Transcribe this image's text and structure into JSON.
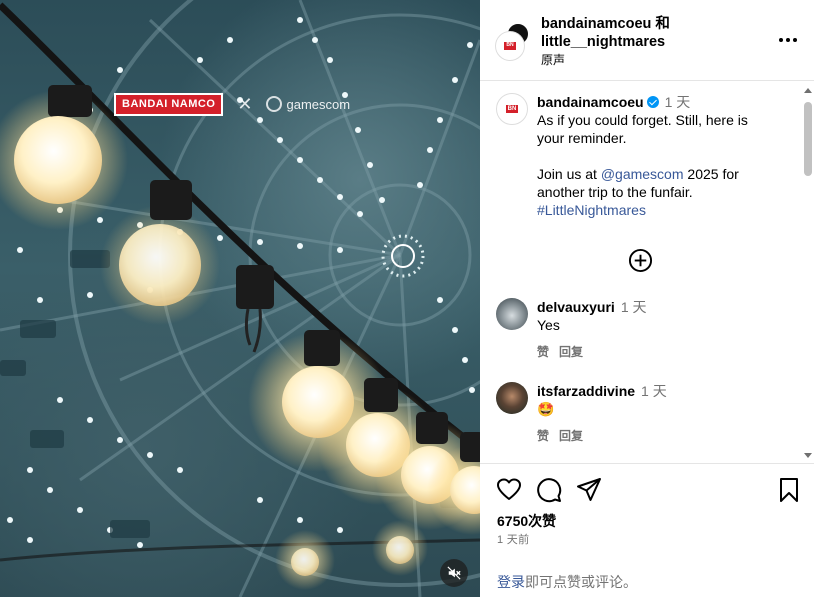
{
  "media": {
    "brand_logo_text": "BANDAI NAMCO",
    "times_symbol": "✕",
    "partner_text": "gamescom",
    "mute_icon": "speaker-muted-icon"
  },
  "header": {
    "title": "bandainamcoeu 和 little__nightmares",
    "subtitle": "原声"
  },
  "caption": {
    "username": "bandainamcoeu",
    "time": "1 天",
    "line1": "As if you could forget. Still, here is your reminder.",
    "line2_pre": "Join us at ",
    "mention": "@gamescom",
    "line2_post": " 2025 for another trip to the funfair.",
    "hashtag": "#LittleNightmares"
  },
  "comments": [
    {
      "username": "delvauxyuri",
      "time": "1 天",
      "text": "Yes",
      "like": "赞",
      "reply": "回复"
    },
    {
      "username": "itsfarzaddivine",
      "time": "1 天",
      "text": "🤩",
      "like": "赞",
      "reply": "回复"
    }
  ],
  "stats": {
    "likes": "6750次赞",
    "posted": "1 天前"
  },
  "login": {
    "link": "登录",
    "rest": "即可点赞或评论。"
  },
  "colors": {
    "link": "#385898",
    "muted": "#737373",
    "verified": "#0095f6",
    "brand_red": "#d4202a"
  }
}
